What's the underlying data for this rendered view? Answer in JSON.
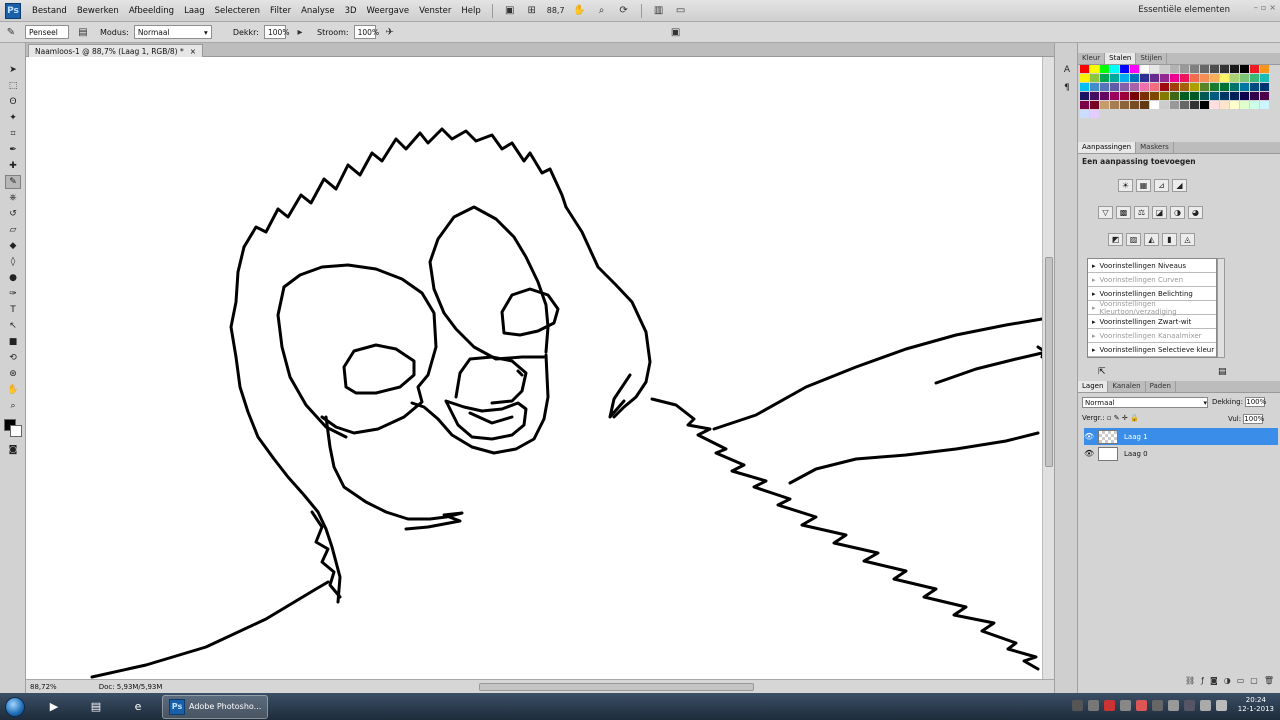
{
  "menubar": {
    "app_logo": "Ps",
    "items": [
      "Bestand",
      "Bewerken",
      "Afbeelding",
      "Laag",
      "Selecteren",
      "Filter",
      "Analyse",
      "3D",
      "Weergave",
      "Venster",
      "Help"
    ],
    "zoom": "88,7",
    "workspace": "Essentiële elementen"
  },
  "options": {
    "preset_label": "Penseel",
    "mode_label": "Modus:",
    "mode_value": "Normaal",
    "opacity_label": "Dekkr:",
    "opacity_value": "100%",
    "flow_label": "Stroom:",
    "flow_value": "100%"
  },
  "document": {
    "tab_title": "Naamloos-1 @ 88,7% (Laag 1, RGB/8) *",
    "close": "×",
    "status_zoom": "88,72%",
    "status_doc": "Doc: 5,93M/5,93M"
  },
  "panels": {
    "color_tabs": [
      "Kleur",
      "Stalen",
      "Stijlen"
    ],
    "swatch_colors": [
      "#ff0000",
      "#ffff00",
      "#00ff00",
      "#00ffff",
      "#0000ff",
      "#ff00ff",
      "#ffffff",
      "#e6e6e6",
      "#cccccc",
      "#b3b3b3",
      "#999999",
      "#808080",
      "#666666",
      "#4d4d4d",
      "#333333",
      "#1a1a1a",
      "#000000",
      "#ed1c24",
      "#f7941d",
      "#fff200",
      "#8dc63f",
      "#00a651",
      "#00a99d",
      "#00aeef",
      "#0072bc",
      "#2e3192",
      "#662d91",
      "#92278f",
      "#ec008c",
      "#ed145b",
      "#f26c4f",
      "#f68e56",
      "#fbaf5d",
      "#fff568",
      "#acd373",
      "#7cc576",
      "#3bb878",
      "#1abbb4",
      "#00bff3",
      "#438ccb",
      "#5574b9",
      "#605ca8",
      "#855fa8",
      "#a763a8",
      "#f06ea9",
      "#f26d7d",
      "#9e0b0f",
      "#a0410d",
      "#a3620a",
      "#aba000",
      "#598527",
      "#197b30",
      "#007236",
      "#00746b",
      "#0076a3",
      "#004a80",
      "#003471",
      "#1b1464",
      "#440e62",
      "#630460",
      "#9e005d",
      "#9e0039",
      "#790000",
      "#7b2e00",
      "#7d4900",
      "#827b00",
      "#406618",
      "#005e20",
      "#005826",
      "#005952",
      "#005b7f",
      "#003663",
      "#002157",
      "#0d004c",
      "#32004b",
      "#4b0049",
      "#7b0046",
      "#7a0026",
      "#c69c6d",
      "#a67c52",
      "#8c6239",
      "#754c24",
      "#603913",
      "#ffffff",
      "#cccccc",
      "#999999",
      "#666666",
      "#333333",
      "#000000",
      "#ffdfdf",
      "#ffe5cc",
      "#ffffcc",
      "#e0ffcc",
      "#ccffe5",
      "#ccf5ff",
      "#ccdcff",
      "#e5ccff"
    ],
    "adjust_tabs": [
      "Aanpassingen",
      "Maskers"
    ],
    "adjust_title": "Een aanpassing toevoegen",
    "adjust_icons_row1": [
      "☀",
      "▦",
      "⊿",
      "◢"
    ],
    "adjust_icons_row2": [
      "▽",
      "▩",
      "⚖",
      "◪",
      "◑",
      "◕"
    ],
    "adjust_icons_row3": [
      "◩",
      "▨",
      "◭",
      "▮",
      "◬"
    ],
    "presets": [
      {
        "label": "Voorinstellingen Niveaus",
        "dim": false
      },
      {
        "label": "Voorinstellingen Curven",
        "dim": true
      },
      {
        "label": "Voorinstellingen Belichting",
        "dim": false
      },
      {
        "label": "Voorinstellingen Kleurtoon/verzadiging",
        "dim": true
      },
      {
        "label": "Voorinstellingen Zwart-wit",
        "dim": false
      },
      {
        "label": "Voorinstellingen Kanaalmixer",
        "dim": true
      },
      {
        "label": "Voorinstellingen Selectieve kleur",
        "dim": false
      }
    ],
    "layers_tabs": [
      "Lagen",
      "Kanalen",
      "Paden"
    ],
    "blend_mode": "Normaal",
    "opacity_label": "Dekking:",
    "opacity_value": "100%",
    "lock_label": "Vergr.:",
    "fill_label": "Vul:",
    "fill_value": "100%",
    "layers": [
      {
        "name": "Laag 1",
        "selected": true,
        "thumb": "trans"
      },
      {
        "name": "Laag 0",
        "selected": false,
        "thumb": "white"
      }
    ]
  },
  "taskbar": {
    "app_label": "Adobe Photosho...",
    "time": "20:24",
    "date": "12-1-2013"
  },
  "colors": {
    "foreground": "#000000",
    "background": "#ffffff",
    "selection": "#3a8de8"
  }
}
